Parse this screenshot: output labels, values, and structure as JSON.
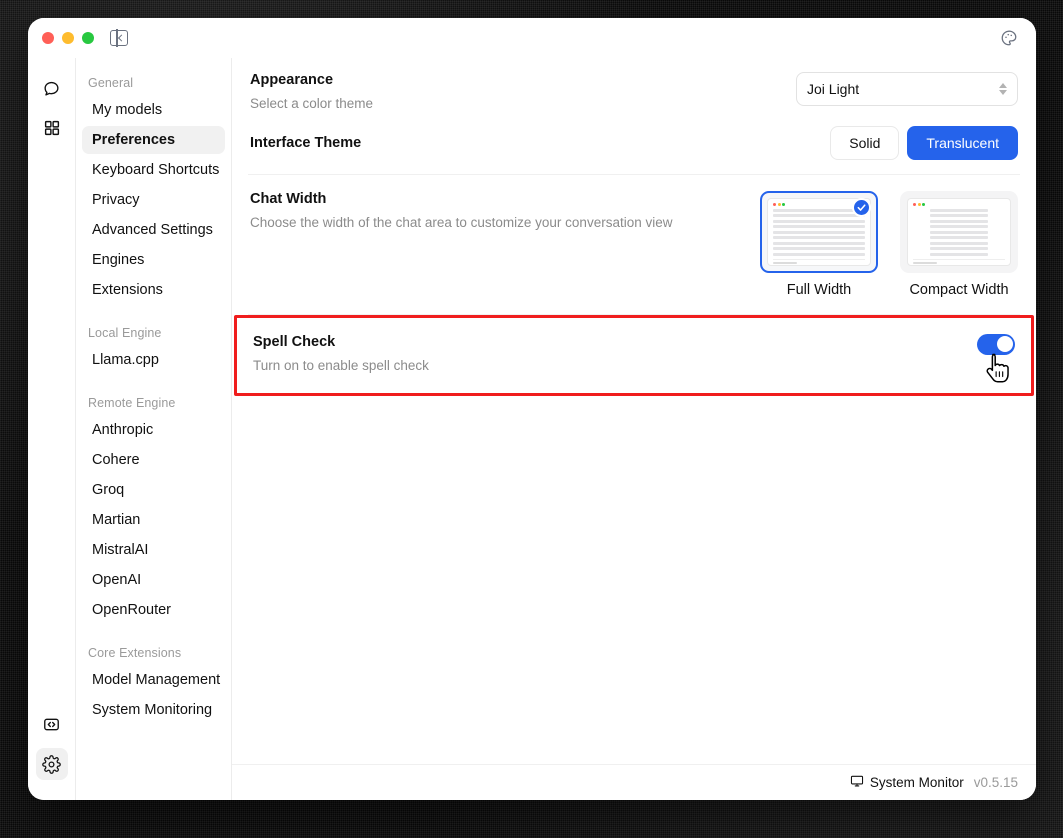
{
  "window": {
    "traffic_lights": [
      "close",
      "minimize",
      "maximize"
    ],
    "sidebar_toggle_icon": "panel-collapse-icon",
    "palette_icon": "palette-icon"
  },
  "rail": {
    "items": [
      {
        "icon": "chat-bubble-icon",
        "active": false
      },
      {
        "icon": "grid-apps-icon",
        "active": false
      }
    ],
    "bottom_items": [
      {
        "icon": "code-brackets-icon",
        "active": false
      },
      {
        "icon": "gear-icon",
        "active": true
      }
    ]
  },
  "sidebar": {
    "groups": [
      {
        "label": "General",
        "items": [
          {
            "label": "My models",
            "active": false
          },
          {
            "label": "Preferences",
            "active": true
          },
          {
            "label": "Keyboard Shortcuts",
            "active": false
          },
          {
            "label": "Privacy",
            "active": false
          },
          {
            "label": "Advanced Settings",
            "active": false
          },
          {
            "label": "Engines",
            "active": false
          },
          {
            "label": "Extensions",
            "active": false
          }
        ]
      },
      {
        "label": "Local Engine",
        "items": [
          {
            "label": "Llama.cpp",
            "active": false
          }
        ]
      },
      {
        "label": "Remote Engine",
        "items": [
          {
            "label": "Anthropic",
            "active": false
          },
          {
            "label": "Cohere",
            "active": false
          },
          {
            "label": "Groq",
            "active": false
          },
          {
            "label": "Martian",
            "active": false
          },
          {
            "label": "MistralAI",
            "active": false
          },
          {
            "label": "OpenAI",
            "active": false
          },
          {
            "label": "OpenRouter",
            "active": false
          }
        ]
      },
      {
        "label": "Core Extensions",
        "items": [
          {
            "label": "Model Management",
            "active": false
          },
          {
            "label": "System Monitoring",
            "active": false
          }
        ]
      }
    ]
  },
  "main": {
    "appearance": {
      "title": "Appearance",
      "description": "Select a color theme",
      "selected_theme": "Joi Light"
    },
    "interface_theme": {
      "title": "Interface Theme",
      "options": [
        {
          "label": "Solid",
          "selected": false
        },
        {
          "label": "Translucent",
          "selected": true
        }
      ]
    },
    "chat_width": {
      "title": "Chat Width",
      "description": "Choose the width of the chat area to customize your conversation view",
      "options": [
        {
          "label": "Full Width",
          "selected": true
        },
        {
          "label": "Compact Width",
          "selected": false
        }
      ]
    },
    "spell_check": {
      "title": "Spell Check",
      "description": "Turn on to enable spell check",
      "enabled": true,
      "highlighted": true,
      "highlight_color": "#f01d1d"
    }
  },
  "statusbar": {
    "system_monitor_label": "System Monitor",
    "monitor_icon": "monitor-icon",
    "version": "v0.5.15"
  },
  "colors": {
    "accent": "#2563eb",
    "highlight": "#f01d1d",
    "sidebar_active_bg": "#f1f1f1",
    "muted_text": "#8b8b8b"
  }
}
